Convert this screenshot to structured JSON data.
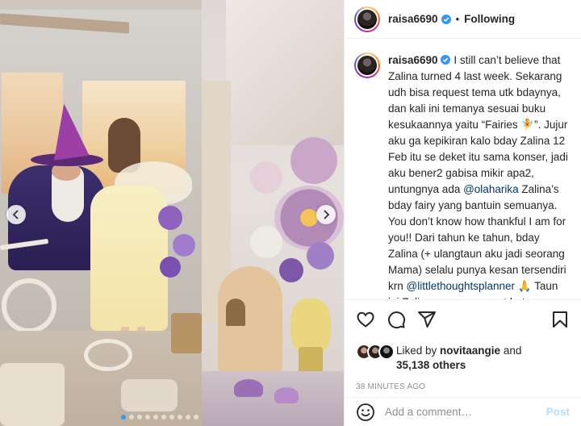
{
  "post": {
    "username": "raisa6690",
    "separator": "•",
    "follow_status": "Following"
  },
  "caption": {
    "username": "raisa6690",
    "text_1": " I still can’t believe that Zalina turned 4 last week. Sekarang udh bisa request tema utk bdaynya, dan kali ini temanya sesuai buku kesukaannya yaitu “Fairies 🧚”. Jujur aku ga kepikiran kalo bday Zalina 12 Feb itu se deket itu sama konser, jadi aku bener2 gabisa mikir apa2, untungnya ada ",
    "mention_1": "@olaharika",
    "text_2": " Zalina’s bday fairy yang bantuin semuanya. You don’t know how thankful I am for you!! Dari tahun ke tahun, bday Zalina (+ ulangtaun aku jadi seorang Mama) selalu punya kesan tersendiri krn ",
    "mention_2": "@littlethoughtsplanner",
    "text_3": " 🙏 Taun ini Zalina sampe request bgt pengen ketemu Tante Ola karena dikira dia itu mistis “bday fairy” and gave her a genuine hug awwwww ❤️. Tahun ini"
  },
  "likes": {
    "prefix": "Liked by ",
    "user": "novitaangie",
    "and": " and",
    "others": "35,138 others"
  },
  "timestamp": "38 MINUTES AGO",
  "comment": {
    "placeholder": "Add a comment…",
    "post_label": "Post"
  },
  "carousel": {
    "dot_count": 10,
    "active_index": 0
  },
  "colors": {
    "verified": "#3897f0",
    "mention": "#00376b",
    "post_button": "#b2dffc",
    "timestamp": "#8e8e8e"
  },
  "icons": [
    "verified-badge-icon",
    "heart-icon",
    "comment-icon",
    "share-icon",
    "bookmark-icon",
    "emoji-icon",
    "chevron-left-icon",
    "chevron-right-icon"
  ]
}
